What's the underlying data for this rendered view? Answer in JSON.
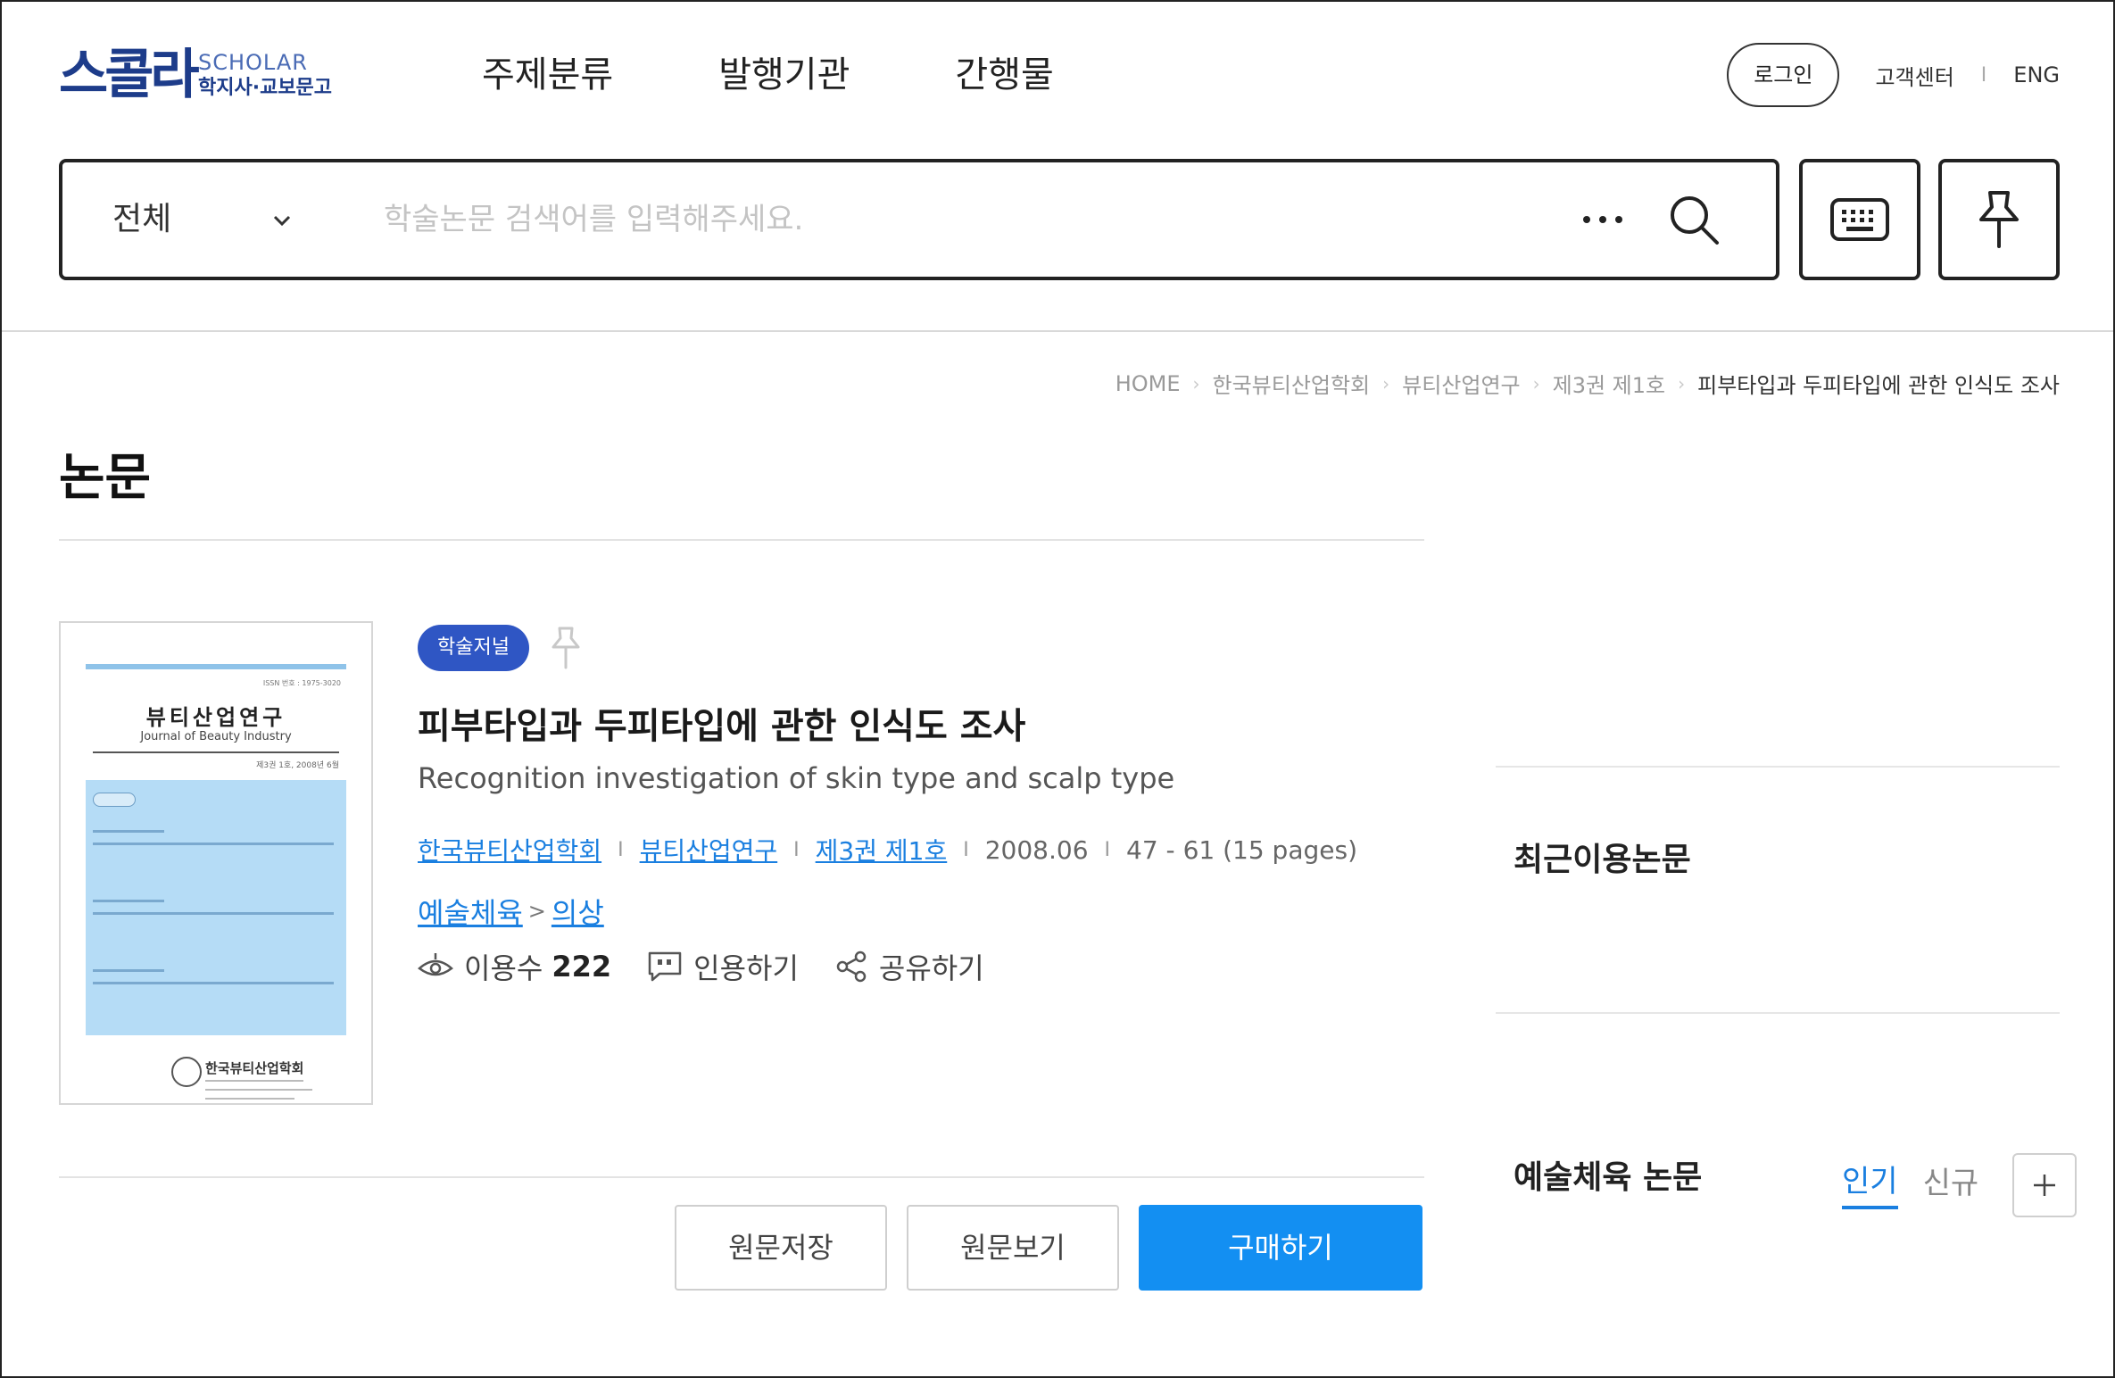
{
  "brand": {
    "logo_ko": "스콜라",
    "logo_en": "SCHOLAR",
    "logo_sub": "학지사·교보문고"
  },
  "gnb": [
    "주제분류",
    "발행기관",
    "간행물"
  ],
  "util": {
    "login": "로그인",
    "support": "고객센터",
    "separator": "I",
    "lang": "ENG"
  },
  "search": {
    "category": "전체",
    "placeholder": "학술논문 검색어를 입력해주세요."
  },
  "icons": {
    "keyboard": "keyboard-icon",
    "pin": "pin-icon",
    "search": "search-icon",
    "more": "more-dots-icon"
  },
  "breadcrumb": [
    "HOME",
    "한국뷰티산업학회",
    "뷰티산업연구",
    "제3권 제1호",
    "피부타입과 두피타입에 관한 인식도 조사"
  ],
  "page_title": "논문",
  "cover": {
    "issn": "ISSN 번호 : 1975-3020",
    "title": "뷰티산업연구",
    "en_title": "Journal of Beauty Industry",
    "vol": "제3권 1호, 2008년 6월",
    "publisher": "한국뷰티산업학회",
    "seal": "KSBI"
  },
  "paper": {
    "badge": "학술저널",
    "title": "피부타입과 두피타입에 관한 인식도 조사",
    "subtitle": "Recognition investigation of skin type and scalp type",
    "publisher": "한국뷰티산업학회",
    "journal": "뷰티산업연구",
    "issue": "제3권 제1호",
    "date": "2008.06",
    "pages": "47 - 61 (15 pages)",
    "meta_sep": "I",
    "category": "예술체육",
    "subcategory": "의상",
    "category_arrow": ">",
    "views_label": "이용수",
    "views": "222",
    "cite_label": "인용하기",
    "share_label": "공유하기"
  },
  "buttons": {
    "save": "원문저장",
    "view": "원문보기",
    "buy": "구매하기"
  },
  "sidebar": {
    "recent_heading": "최근이용논문",
    "category_heading": "예술체육 논문",
    "tabs": [
      "인기",
      "신규"
    ]
  },
  "colors": {
    "accent": "#138ff2",
    "link": "#1a7fe0",
    "badge": "#2f56c4",
    "brand": "#1d3c8a"
  }
}
